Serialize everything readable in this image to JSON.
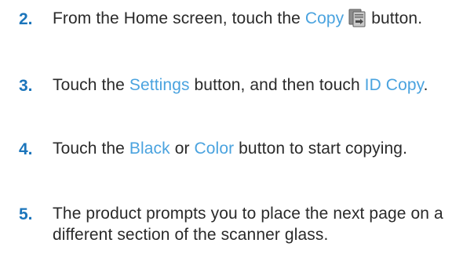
{
  "colors": {
    "text": "#2a2a2a",
    "step_number": "#1b75bb",
    "ui_term": "#4aa3df"
  },
  "steps": [
    {
      "number": "2.",
      "parts": [
        {
          "type": "text",
          "value": "From the Home screen, touch the "
        },
        {
          "type": "term",
          "value": "Copy"
        },
        {
          "type": "icon",
          "icon": "copy-icon"
        },
        {
          "type": "text",
          "value": " button."
        }
      ]
    },
    {
      "number": "3.",
      "parts": [
        {
          "type": "text",
          "value": "Touch the "
        },
        {
          "type": "term",
          "value": "Settings"
        },
        {
          "type": "text",
          "value": " button, and then touch "
        },
        {
          "type": "term",
          "value": "ID Copy"
        },
        {
          "type": "text",
          "value": "."
        }
      ]
    },
    {
      "number": "4.",
      "parts": [
        {
          "type": "text",
          "value": "Touch the "
        },
        {
          "type": "term",
          "value": "Black"
        },
        {
          "type": "text",
          "value": " or "
        },
        {
          "type": "term",
          "value": "Color"
        },
        {
          "type": "text",
          "value": " button to start copying."
        }
      ]
    },
    {
      "number": "5.",
      "parts": [
        {
          "type": "text",
          "value": "The product prompts you to place the next page on a different section of the scanner glass."
        }
      ]
    }
  ]
}
